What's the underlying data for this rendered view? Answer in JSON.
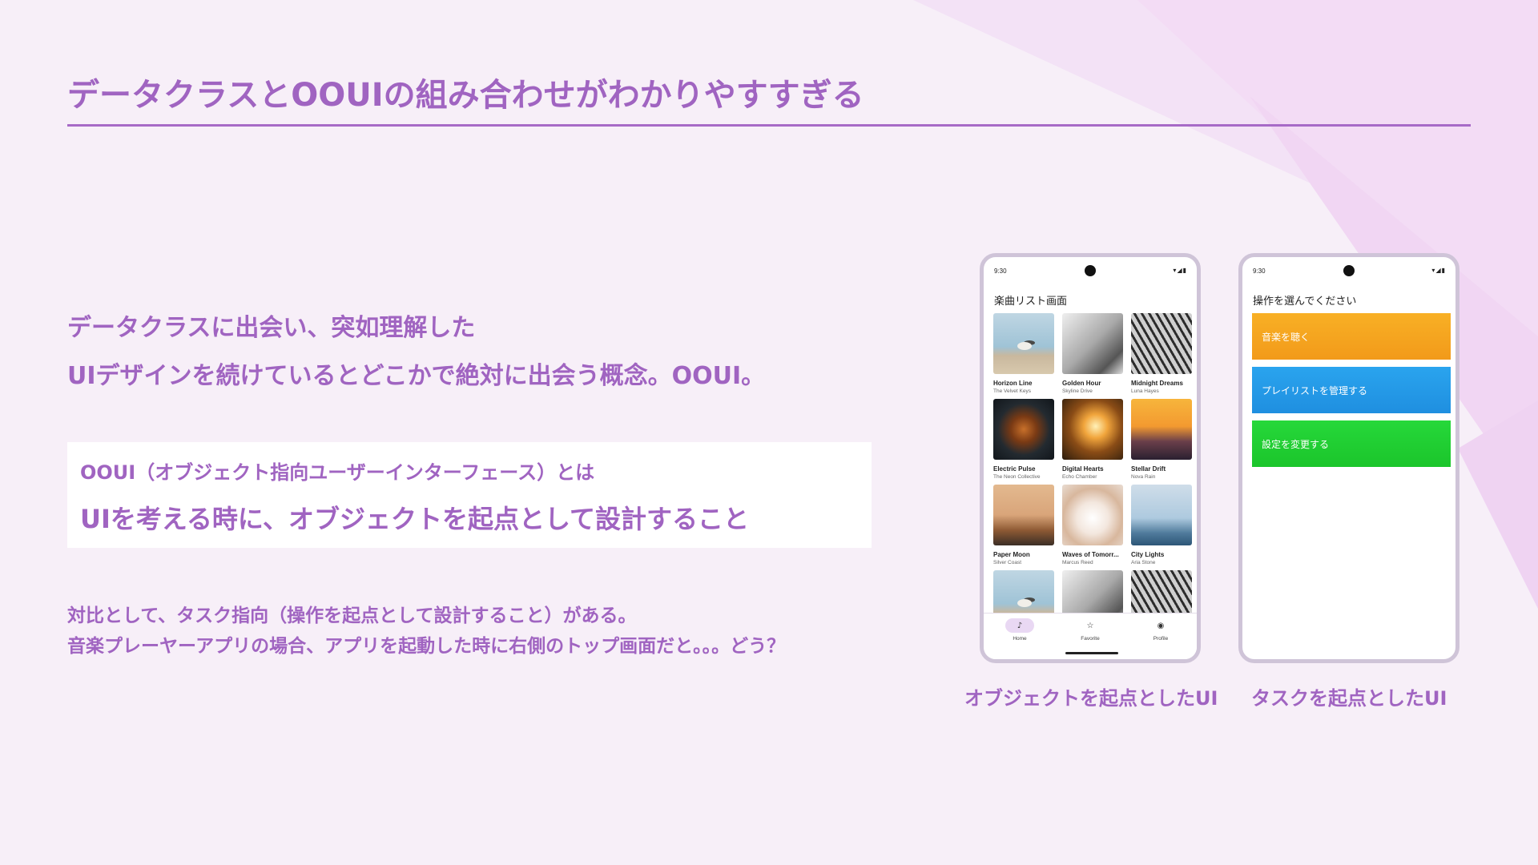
{
  "slide": {
    "title": "データクラスとOOUIの組み合わせがわかりやすすぎる",
    "intro": [
      "データクラスに出会い、突如理解した",
      "UIデザインを続けているとどこかで絶対に出会う概念。OOUI。"
    ],
    "definition": {
      "label": "OOUI（オブジェクト指向ユーザーインターフェース）とは",
      "text": "UIを考える時に、オブジェクトを起点として設計すること"
    },
    "contrast": [
      "対比として、タスク指向（操作を起点として設計すること）がある。",
      "音楽プレーヤーアプリの場合、アプリを起動した時に右側のトップ画面だと。。。どう？"
    ],
    "captions": {
      "object": "オブジェクトを起点としたUI",
      "task": "タスクを起点としたUI"
    }
  },
  "colors": {
    "accent": "#a064c1",
    "background": "#f7eff8",
    "music_button": "#f6a720",
    "playlist_button": "#249ae8",
    "settings_button": "#21d033"
  },
  "phone_object": {
    "time": "9:30",
    "screen_title": "楽曲リスト画面",
    "songs": [
      {
        "title": "Horizon Line",
        "artist": "The Velvet Keys",
        "art": "bird"
      },
      {
        "title": "Golden Hour",
        "artist": "Skyline Drive",
        "art": "rhino"
      },
      {
        "title": "Midnight Dreams",
        "artist": "Luna Hayes",
        "art": "wheel"
      },
      {
        "title": "Electric Pulse",
        "artist": "The Neon Collective",
        "art": "leaf"
      },
      {
        "title": "Digital Hearts",
        "artist": "Echo Chamber",
        "art": "forest"
      },
      {
        "title": "Stellar Drift",
        "artist": "Nova Rain",
        "art": "sunset"
      },
      {
        "title": "Paper Moon",
        "artist": "Silver Coast",
        "art": "car"
      },
      {
        "title": "Waves of Tomorr...",
        "artist": "Marcus Reed",
        "art": "cat"
      },
      {
        "title": "City Lights",
        "artist": "Aria Stone",
        "art": "wind"
      }
    ],
    "nav": [
      {
        "label": "Home",
        "icon": "music-note-icon",
        "active": true
      },
      {
        "label": "Favorite",
        "icon": "star-icon",
        "active": false
      },
      {
        "label": "Profile",
        "icon": "profile-icon",
        "active": false
      }
    ]
  },
  "phone_task": {
    "time": "9:30",
    "screen_title": "操作を選んでください",
    "buttons": [
      {
        "label": "音楽を聴く"
      },
      {
        "label": "プレイリストを管理する"
      },
      {
        "label": "設定を変更する"
      }
    ]
  }
}
